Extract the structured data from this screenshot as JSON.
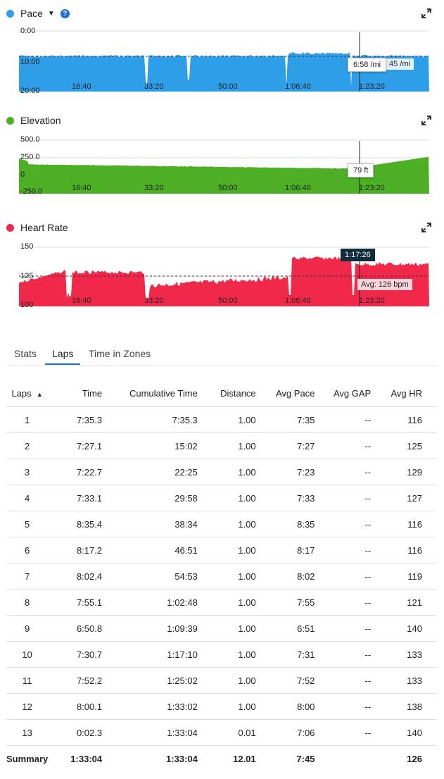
{
  "pace_chart": {
    "legend_label": "Pace",
    "color": "#2e9ee8",
    "y_ticks": [
      "0:00",
      "10:00",
      "20:00"
    ],
    "x_ticks": [
      "16:40",
      "33:20",
      "50:00",
      "1:06:40",
      "1:23:20"
    ],
    "tooltip": "6:58 /mi",
    "avg_label": "45 /mi"
  },
  "elevation_chart": {
    "legend_label": "Elevation",
    "color": "#4caf24",
    "y_ticks": [
      "500.0",
      "250.0",
      "0",
      "-250.0"
    ],
    "x_ticks": [
      "16:40",
      "33:20",
      "50:00",
      "1:06:40",
      "1:23:20"
    ],
    "tooltip": "79 ft"
  },
  "hr_chart": {
    "legend_label": "Heart Rate",
    "color": "#f0284a",
    "y_ticks": [
      "150",
      "125",
      "100"
    ],
    "x_ticks": [
      "16:40",
      "33:20",
      "50:00",
      "1:06:40",
      "1:23:20"
    ],
    "tooltip": "1:17:26",
    "avg_label": "Avg: 126 bpm"
  },
  "tabs": [
    "Stats",
    "Laps",
    "Time in Zones"
  ],
  "active_tab": "Laps",
  "table": {
    "headers": [
      "Laps",
      "Time",
      "Cumulative Time",
      "Distance",
      "Avg Pace",
      "Avg GAP",
      "Avg HR"
    ],
    "sort_indicator": "▲",
    "rows": [
      [
        "1",
        "7:35.3",
        "7:35.3",
        "1.00",
        "7:35",
        "--",
        "116"
      ],
      [
        "2",
        "7:27.1",
        "15:02",
        "1.00",
        "7:27",
        "--",
        "125"
      ],
      [
        "3",
        "7:22.7",
        "22:25",
        "1.00",
        "7:23",
        "--",
        "129"
      ],
      [
        "4",
        "7:33.1",
        "29:58",
        "1.00",
        "7:33",
        "--",
        "127"
      ],
      [
        "5",
        "8:35.4",
        "38:34",
        "1.00",
        "8:35",
        "--",
        "116"
      ],
      [
        "6",
        "8:17.2",
        "46:51",
        "1.00",
        "8:17",
        "--",
        "116"
      ],
      [
        "7",
        "8:02.4",
        "54:53",
        "1.00",
        "8:02",
        "--",
        "119"
      ],
      [
        "8",
        "7:55.1",
        "1:02:48",
        "1.00",
        "7:55",
        "--",
        "121"
      ],
      [
        "9",
        "6:50.8",
        "1:09:39",
        "1.00",
        "6:51",
        "--",
        "140"
      ],
      [
        "10",
        "7:30.7",
        "1:17:10",
        "1.00",
        "7:31",
        "--",
        "133"
      ],
      [
        "11",
        "7:52.2",
        "1:25:02",
        "1.00",
        "7:52",
        "--",
        "133"
      ],
      [
        "12",
        "8:00.1",
        "1:33:02",
        "1.00",
        "8:00",
        "--",
        "138"
      ],
      [
        "13",
        "0:02.3",
        "1:33:04",
        "0.01",
        "7:06",
        "--",
        "140"
      ]
    ],
    "summary": [
      "Summary",
      "1:33:04",
      "1:33:04",
      "12.01",
      "7:45",
      "",
      "126"
    ]
  }
}
